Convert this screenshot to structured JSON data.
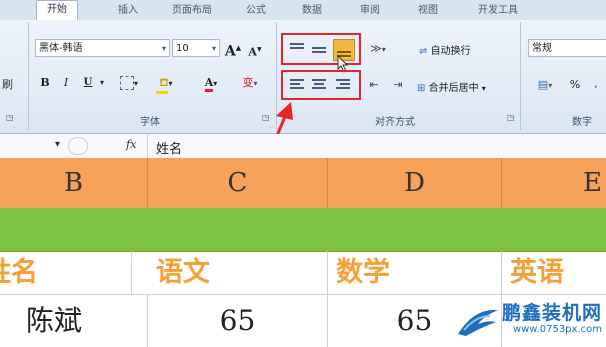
{
  "tabs": [
    "开始",
    "插入",
    "页面布局",
    "公式",
    "数据",
    "审阅",
    "视图",
    "开发工具"
  ],
  "ribbon": {
    "clipboard_partial_label": "刷",
    "font": {
      "name": "黑体-韩语",
      "size": "10",
      "grow_label": "A",
      "shrink_label": "A",
      "bold": "B",
      "italic": "I",
      "underline": "U",
      "font_color_label": "A",
      "phonetic_label": "变",
      "group_label": "字体"
    },
    "alignment": {
      "wrap_text": "自动换行",
      "merge_center": "合并后居中",
      "group_label": "对齐方式"
    },
    "number": {
      "format": "常规",
      "percent": "%",
      "group_label": "数字"
    }
  },
  "formula_bar": {
    "fx": "fx",
    "content": "姓名"
  },
  "sheet": {
    "columns": [
      "B",
      "C",
      "D",
      "E"
    ],
    "header_row": [
      "姓名",
      "语文",
      "数学",
      "英语"
    ],
    "data_row": [
      "陈斌",
      "65",
      "65",
      ""
    ]
  },
  "watermark": {
    "brand": "鹏鑫装机网",
    "url": "www.0753px.com"
  },
  "colors": {
    "highlight_box": "#e3262b",
    "arrow": "#e3262b",
    "column_header_bg": "#f6a259",
    "green_row": "#7fc241",
    "header_text": "#f4a036"
  }
}
